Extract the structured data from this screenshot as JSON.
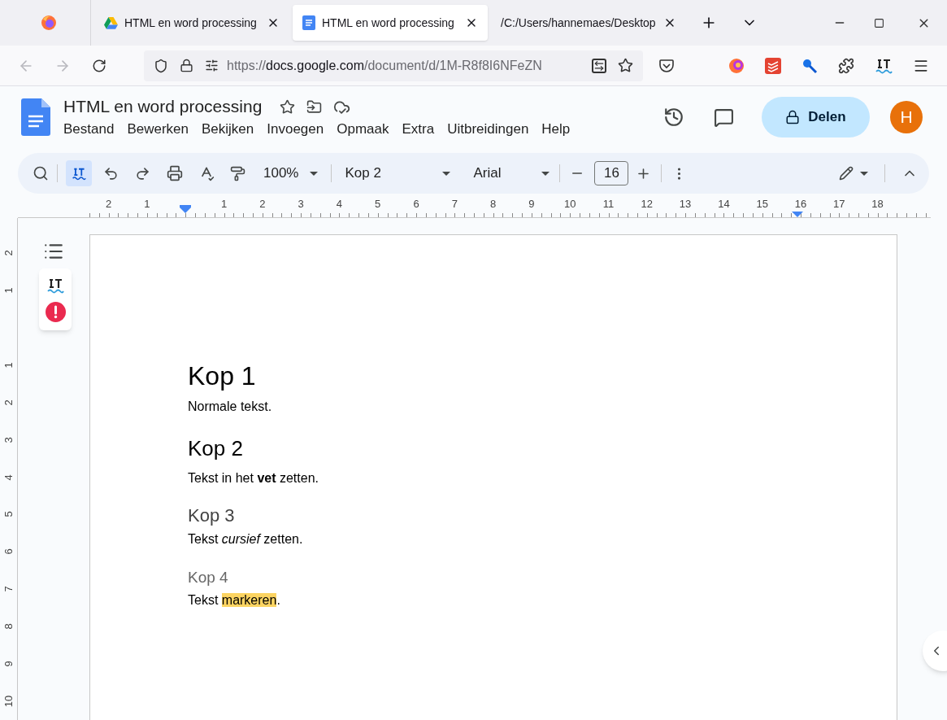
{
  "browser": {
    "tabs": [
      {
        "kind": "drive",
        "title": "HTML en word processing",
        "selected": false
      },
      {
        "kind": "docs",
        "title": "HTML en word processing",
        "selected": true
      },
      {
        "kind": "file",
        "title": "/C:/Users/hannemaes/Desktop",
        "selected": false
      }
    ],
    "url": [
      {
        "kind": "dim",
        "text": "https://"
      },
      {
        "kind": "host",
        "text": "docs.google.com"
      },
      {
        "kind": "dim",
        "text": "/document/d/1M-R8f8I6NFeZN"
      }
    ]
  },
  "doc": {
    "title": "HTML en word processing",
    "menu": [
      "Bestand",
      "Bewerken",
      "Bekijken",
      "Invoegen",
      "Opmaak",
      "Extra",
      "Uitbreidingen",
      "Help"
    ],
    "share": "Delen",
    "avatar": {
      "text": "H",
      "color": "#e8710a"
    }
  },
  "toolbar": {
    "spelling_toggle": {
      "selected": true
    },
    "zoom": "100%",
    "style": "Kop 2",
    "font": "Arial",
    "size": "16"
  },
  "ruler": {
    "numbers": [
      "2",
      "1",
      "1",
      "2",
      "3",
      "4",
      "5",
      "6",
      "7",
      "8",
      "9",
      "10",
      "11",
      "12",
      "13",
      "14",
      "15",
      "16",
      "17",
      "18"
    ]
  },
  "vertical_ruler": {
    "numbers": [
      "2",
      "1",
      "1",
      "2",
      "3",
      "4",
      "5",
      "6",
      "7",
      "8",
      "9",
      "10"
    ]
  },
  "content": [
    {
      "kind": "h1",
      "text": "Kop 1"
    },
    {
      "kind": "p",
      "parts": [
        {
          "kind": "normal",
          "text": "Normale tekst."
        }
      ]
    },
    {
      "kind": "h2",
      "text": "Kop 2"
    },
    {
      "kind": "p",
      "parts": [
        {
          "kind": "normal",
          "text": "Tekst in het "
        },
        {
          "kind": "bold",
          "text": "vet"
        },
        {
          "kind": "normal",
          "text": " zetten."
        }
      ]
    },
    {
      "kind": "h3",
      "text": "Kop 3"
    },
    {
      "kind": "p",
      "parts": [
        {
          "kind": "normal",
          "text": "Tekst "
        },
        {
          "kind": "italic",
          "text": "cursief"
        },
        {
          "kind": "normal",
          "text": " zetten."
        }
      ]
    },
    {
      "kind": "h4",
      "text": "Kop 4"
    },
    {
      "kind": "p",
      "parts": [
        {
          "kind": "normal",
          "text": "Tekst "
        },
        {
          "kind": "highlight",
          "text": "markeren"
        },
        {
          "kind": "normal",
          "text": "."
        }
      ]
    }
  ]
}
